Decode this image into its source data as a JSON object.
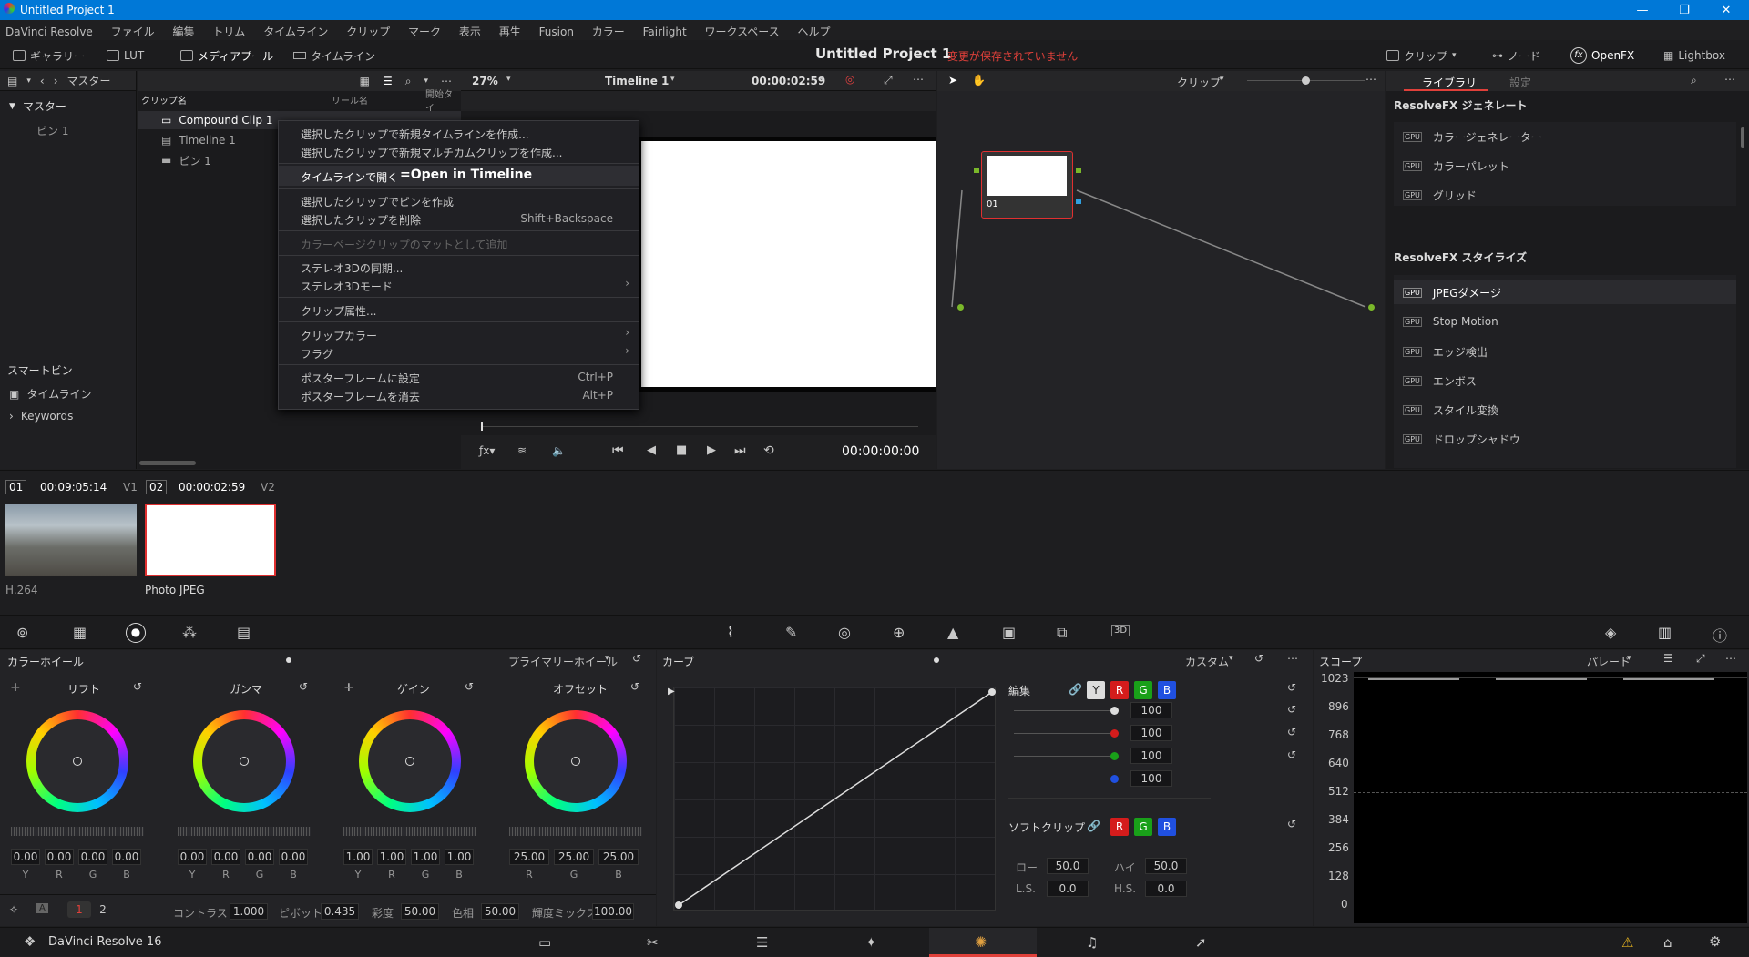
{
  "window": {
    "title": "Untitled Project 1"
  },
  "menubar": [
    "DaVinci Resolve",
    "ファイル",
    "編集",
    "トリム",
    "タイムライン",
    "クリップ",
    "マーク",
    "表示",
    "再生",
    "Fusion",
    "カラー",
    "Fairlight",
    "ワークスペース",
    "ヘルプ"
  ],
  "toolbar": {
    "gallery": "ギャラリー",
    "lut": "LUT",
    "mediapool": "メディアプール",
    "timeline": "タイムライン",
    "project": "Untitled Project 1",
    "unsaved": "変更が保存されていません",
    "clip": "クリップ",
    "node": "ノード",
    "openfx": "OpenFX",
    "lightbox": "Lightbox"
  },
  "left": {
    "header": "マスター",
    "master": "マスター",
    "bin": "ビン 1",
    "smartbin": "スマートビン",
    "sb_timeline": "タイムライン",
    "keywords": "Keywords"
  },
  "bin": {
    "col_name": "クリップ名",
    "col_reel": "リール名",
    "col_start": "開始タイ",
    "items": [
      "Compound Clip 1",
      "Timeline 1",
      "ビン 1"
    ]
  },
  "viewer": {
    "zoom": "27%",
    "timeline": "Timeline 1",
    "tc": "00:00:02:59",
    "timecode": "00:00:00:00"
  },
  "nodes": {
    "mode": "クリップ",
    "node_label": "01"
  },
  "library": {
    "tab_library": "ライブラリ",
    "tab_settings": "設定",
    "gen_header": "ResolveFX ジェネレート",
    "gen": [
      "カラージェネレーター",
      "カラーパレット",
      "グリッド"
    ],
    "style_header": "ResolveFX スタイライズ",
    "style": [
      "JPEGダメージ",
      "Stop Motion",
      "エッジ検出",
      "エンボス",
      "スタイル変換",
      "ドロップシャドウ"
    ]
  },
  "menu": {
    "items": [
      "選択したクリップで新規タイムラインを作成...",
      "選択したクリップで新規マルチカムクリップを作成...",
      "タイムラインで開く",
      "選択したクリップでビンを作成",
      "選択したクリップを削除",
      "カラーページクリップのマットとして追加",
      "ステレオ3Dの同期...",
      "ステレオ3Dモード",
      "クリップ属性...",
      "クリップカラー",
      "フラグ",
      "ポスターフレームに設定",
      "ポスターフレームを消去"
    ],
    "annotation": "=Open in Timeline",
    "sc_delete": "Shift+Backspace",
    "sc_set": "Ctrl+P",
    "sc_clear": "Alt+P"
  },
  "strip": {
    "c1num": "01",
    "c1tc": "00:09:05:14",
    "c1track": "V1",
    "c1codec": "H.264",
    "c2num": "02",
    "c2tc": "00:00:02:59",
    "c2track": "V2",
    "c2codec": "Photo JPEG"
  },
  "colorwheels": {
    "title": "カラーホイール",
    "mode": "プライマリーホイール",
    "wheels": [
      {
        "name": "リフト",
        "vals": [
          "0.00",
          "0.00",
          "0.00",
          "0.00"
        ]
      },
      {
        "name": "ガンマ",
        "vals": [
          "0.00",
          "0.00",
          "0.00",
          "0.00"
        ]
      },
      {
        "name": "ゲイン",
        "vals": [
          "1.00",
          "1.00",
          "1.00",
          "1.00"
        ]
      },
      {
        "name": "オフセット",
        "vals": [
          "25.00",
          "25.00",
          "25.00"
        ]
      }
    ],
    "ch4": [
      "Y",
      "R",
      "G",
      "B"
    ],
    "ch3": [
      "R",
      "G",
      "B"
    ],
    "contrast_lbl": "コントラスト",
    "contrast": "1.000",
    "pivot_lbl": "ピボット",
    "pivot": "0.435",
    "sat_lbl": "彩度",
    "sat": "50.00",
    "hue_lbl": "色相",
    "hue": "50.00",
    "lum_lbl": "輝度ミックス",
    "lum": "100.00",
    "p1": "1",
    "p2": "2"
  },
  "curves": {
    "title": "カーブ",
    "mode": "カスタム",
    "edit": "編集",
    "vals": [
      "100",
      "100",
      "100",
      "100"
    ],
    "softclip": "ソフトクリップ",
    "low_lbl": "ロー",
    "low": "50.0",
    "high_lbl": "ハイ",
    "high": "50.0",
    "ls_lbl": "L.S.",
    "ls": "0.0",
    "hs_lbl": "H.S.",
    "hs": "0.0"
  },
  "scope": {
    "title": "スコープ",
    "mode": "パレード",
    "ticks": [
      "1023",
      "896",
      "768",
      "640",
      "512",
      "384",
      "256",
      "128",
      "0"
    ]
  },
  "bottom": {
    "app": "DaVinci Resolve 16"
  },
  "colors": {
    "accent": "#e0403a",
    "titlebar": "#0078d7"
  }
}
